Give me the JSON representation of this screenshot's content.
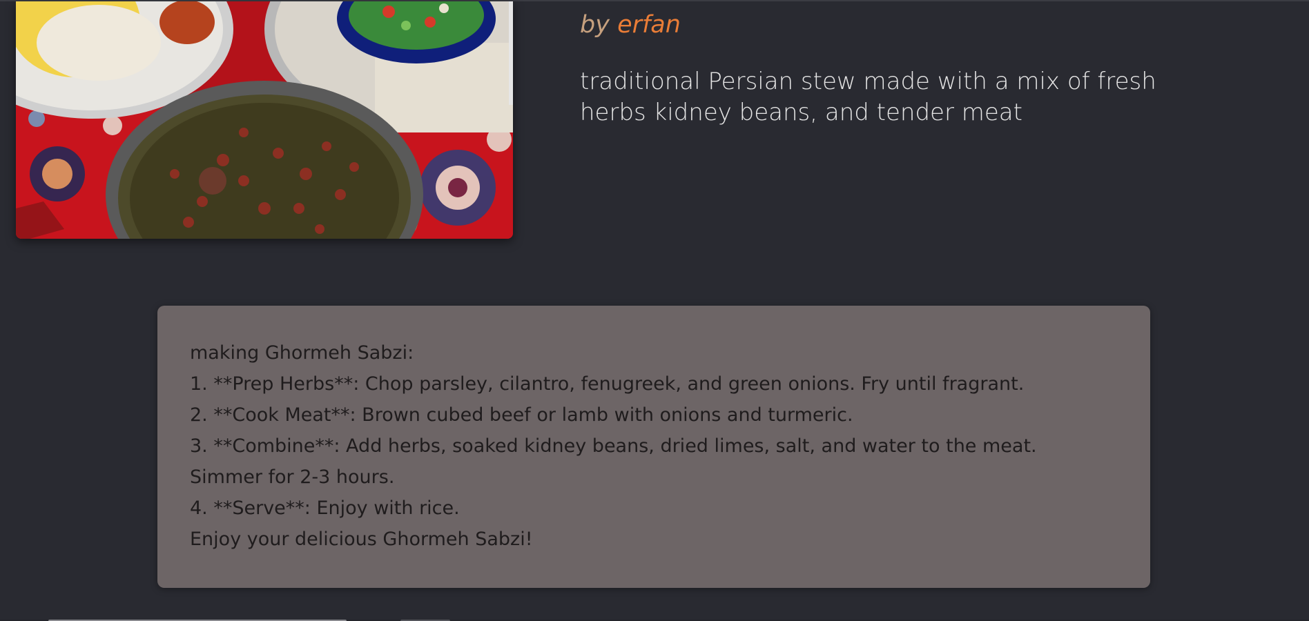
{
  "recipe": {
    "author_prefix": "by ",
    "author_name": "erfan",
    "description": "traditional Persian stew made with a mix of fresh herbs kidney beans, and tender meat",
    "photo_alt": "Ghormeh Sabzi stew with saffron rice and salad on a Persian rug"
  },
  "instructions": {
    "lines": [
      "making Ghormeh Sabzi:",
      "1. **Prep Herbs**: Chop parsley, cilantro, fenugreek, and green onions. Fry until fragrant.",
      "2. **Cook Meat**: Brown cubed beef or lamb with onions and turmeric.",
      "3. **Combine**: Add herbs, soaked kidney beans, dried limes, salt, and water to the meat. Simmer for 2-3 hours.",
      "4. **Serve**: Enjoy with rice.",
      "Enjoy your delicious Ghormeh Sabzi!"
    ]
  },
  "colors": {
    "background": "#292a31",
    "card": "#6d6566",
    "author_accent": "#ea7d37"
  }
}
